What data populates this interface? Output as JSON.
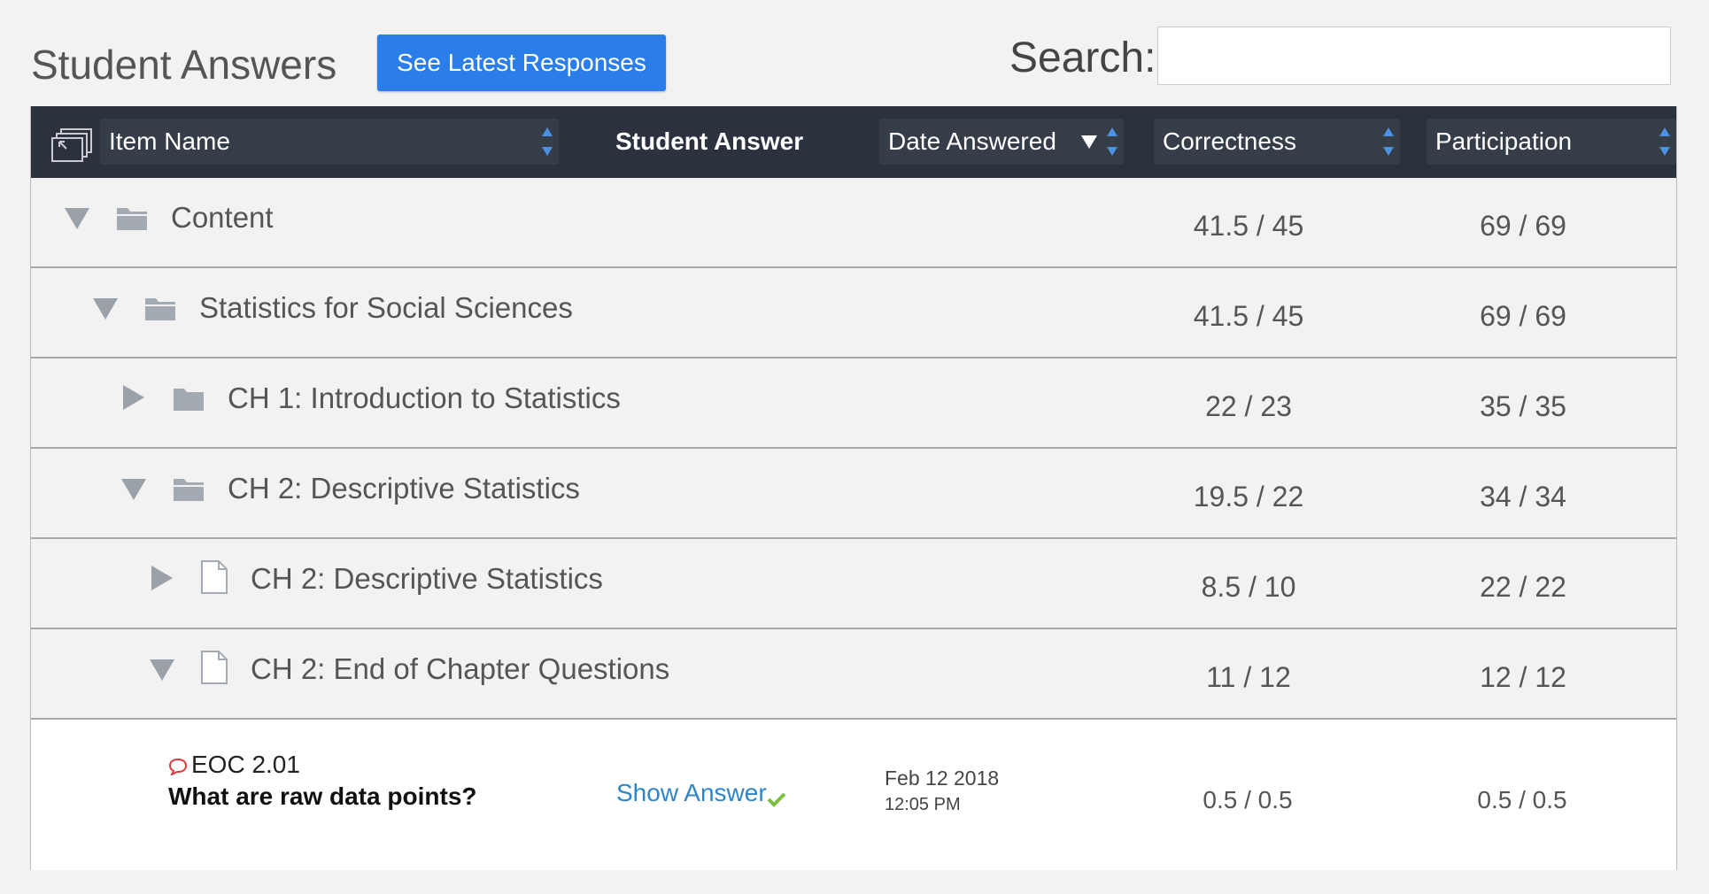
{
  "header": {
    "title": "Student Answers",
    "latest_button": "See Latest Responses",
    "search_label": "Search:",
    "search_value": ""
  },
  "columns": {
    "item_name": "Item Name",
    "student_answer": "Student Answer",
    "date_answered": "Date Answered",
    "correctness": "Correctness",
    "participation": "Participation"
  },
  "rows": [
    {
      "name": "Content",
      "correctness": "41.5 / 45",
      "participation": "69 / 69",
      "expanded": true,
      "icon": "folder-open-icon"
    },
    {
      "name": "Statistics for Social Sciences",
      "correctness": "41.5 / 45",
      "participation": "69 / 69",
      "expanded": true,
      "icon": "folder-open-icon"
    },
    {
      "name": "CH 1: Introduction to Statistics",
      "correctness": "22 / 23",
      "participation": "35 / 35",
      "expanded": false,
      "icon": "folder-icon"
    },
    {
      "name": "CH 2: Descriptive Statistics",
      "correctness": "19.5 / 22",
      "participation": "34 / 34",
      "expanded": true,
      "icon": "folder-open-icon"
    },
    {
      "name": "CH 2: Descriptive Statistics",
      "correctness": "8.5 / 10",
      "participation": "22 / 22",
      "expanded": false,
      "icon": "document-icon"
    },
    {
      "name": "CH 2: End of Chapter Questions",
      "correctness": "11 / 12",
      "participation": "12 / 12",
      "expanded": true,
      "icon": "document-icon"
    }
  ],
  "answer": {
    "label": "EOC 2.01",
    "question": "What are raw data points?",
    "show_answer": "Show Answer",
    "date": "Feb 12 2018",
    "time": "12:05 PM",
    "correctness": "0.5 / 0.5",
    "participation": "0.5 / 0.5"
  },
  "colors": {
    "accent": "#2b7de9",
    "header_bg": "#2b323d",
    "link": "#2e86c9",
    "check": "#7ac142",
    "comment": "#e03a3a"
  }
}
